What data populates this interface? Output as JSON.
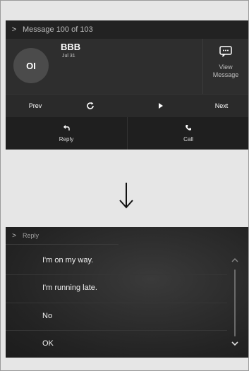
{
  "message_screen": {
    "header": {
      "title": "Message 100 of 103",
      "chevron_icon": "chevron-right-icon"
    },
    "avatar_initials": "OI",
    "sender": "BBB",
    "date": "Jul 31",
    "view_message": {
      "label": "View Message",
      "icon": "message-icon"
    },
    "controls": {
      "prev": "Prev",
      "refresh_icon": "refresh-icon",
      "play_icon": "play-icon",
      "next": "Next"
    },
    "actions": {
      "reply": "Reply",
      "reply_icon": "reply-icon",
      "call": "Call",
      "call_icon": "phone-icon"
    }
  },
  "transition_arrow": "arrow-down-icon",
  "reply_screen": {
    "header": {
      "title": "Reply",
      "chevron_icon": "chevron-right-icon"
    },
    "options": [
      "I'm on my way.",
      "I'm running late.",
      "No",
      "OK"
    ],
    "scroll_up_icon": "chevron-up-icon",
    "scroll_down_icon": "chevron-down-icon"
  },
  "colors": {
    "screen_bg": "#262626",
    "page_bg": "#e6e6e6",
    "text": "#ffffff"
  }
}
